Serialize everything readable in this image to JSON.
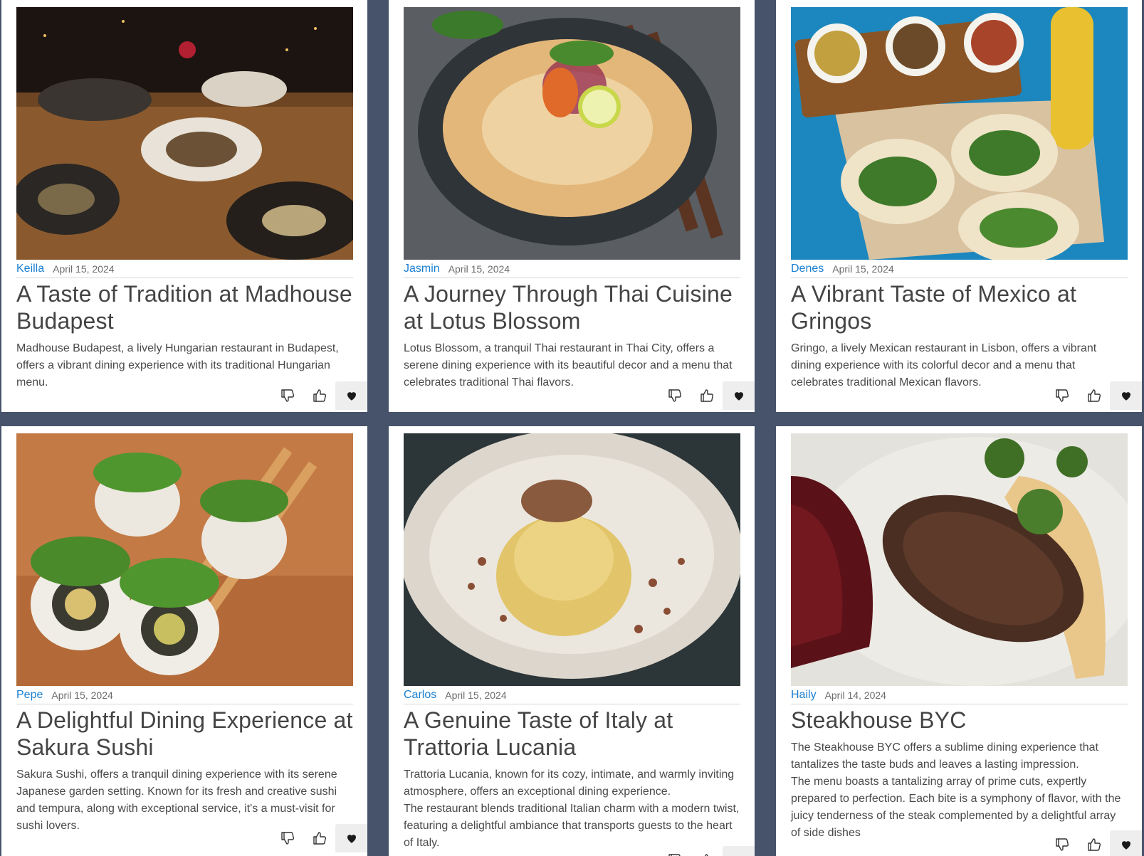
{
  "cards": [
    {
      "image": "restaurant-feast-photo",
      "author": "Keilla",
      "date": "April 15, 2024",
      "title": "A Taste of Tradition at Madhouse Budapest",
      "description": "Madhouse Budapest, a lively Hungarian restaurant in Budapest, offers a vibrant dining experience with its traditional Hungarian menu.",
      "icons": [
        "thumbs-down-icon",
        "thumbs-up-icon",
        "heart-icon"
      ]
    },
    {
      "image": "thai-noodle-soup-photo",
      "author": "Jasmin",
      "date": "April 15, 2024",
      "title": "A Journey Through Thai Cuisine at Lotus Blossom",
      "description": "Lotus Blossom, a tranquil Thai restaurant in Thai City, offers a serene dining experience with its beautiful decor and a menu that celebrates traditional Thai flavors.",
      "icons": [
        "thumbs-down-icon",
        "thumbs-up-icon",
        "heart-icon"
      ]
    },
    {
      "image": "mexican-tacos-photo",
      "author": "Denes",
      "date": "April 15, 2024",
      "title": "A Vibrant Taste of Mexico at Gringos",
      "description": "Gringo, a lively Mexican restaurant in Lisbon, offers a vibrant dining experience with its colorful decor and a menu that celebrates traditional Mexican flavors.",
      "icons": [
        "thumbs-down-icon",
        "thumbs-up-icon",
        "heart-icon"
      ]
    },
    {
      "image": "sushi-rolls-photo",
      "author": "Pepe",
      "date": "April 15, 2024",
      "title": "A Delightful Dining Experience at Sakura Sushi",
      "description": "Sakura Sushi, offers a tranquil dining experience with its serene Japanese garden setting. Known for its fresh and creative sushi and tempura, along with exceptional service, it's a must-visit for sushi lovers.",
      "icons": [
        "thumbs-down-icon",
        "thumbs-up-icon",
        "heart-icon"
      ]
    },
    {
      "image": "pasta-carbonara-photo",
      "author": "Carlos",
      "date": "April 15, 2024",
      "title": "A Genuine Taste of Italy at Trattoria Lucania",
      "description": "Trattoria Lucania, known for its cozy, intimate, and warmly inviting atmosphere, offers an exceptional dining experience.\nThe restaurant blends traditional Italian charm with a modern twist, featuring a delightful ambiance that transports guests to the heart of Italy.",
      "icons": [
        "thumbs-down-icon",
        "thumbs-up-icon",
        "heart-icon"
      ]
    },
    {
      "image": "grilled-steak-photo",
      "author": "Haily",
      "date": "April 14, 2024",
      "title": "Steakhouse BYC",
      "description": "The Steakhouse BYC offers a sublime dining experience that tantalizes the taste buds and leaves a lasting impression.\nThe menu boasts a tantalizing array of prime cuts, expertly prepared to perfection. Each bite is a symphony of flavor, with the juicy tenderness of the steak complemented by a delightful array of side dishes",
      "icons": [
        "thumbs-down-icon",
        "thumbs-up-icon",
        "heart-icon"
      ]
    }
  ],
  "colors": {
    "page_background": "#47536a",
    "card_background": "#ffffff",
    "author_link": "#1a7fd1",
    "title_text": "#444444"
  }
}
